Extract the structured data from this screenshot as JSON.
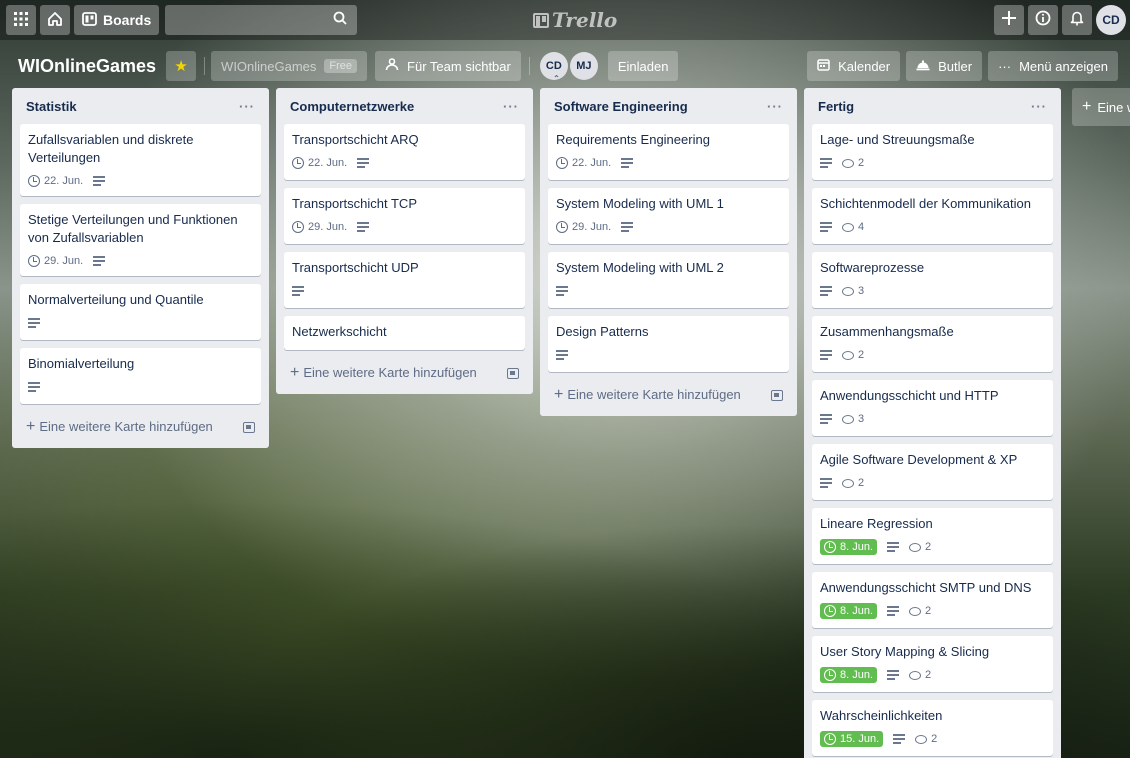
{
  "topbar": {
    "boards_label": "Boards",
    "logo_text": "Trello",
    "avatar_initials": "CD"
  },
  "board": {
    "title": "WIOnlineGames",
    "team_name": "WIOnlineGames",
    "team_plan": "Free",
    "visibility_label": "Für Team sichtbar",
    "members": [
      "CD",
      "MJ"
    ],
    "invite_label": "Einladen",
    "calendar_label": "Kalender",
    "butler_label": "Butler",
    "menu_label": "Menü anzeigen"
  },
  "add_list_label": "Eine w",
  "add_card_label": "Eine weitere Karte hinzufügen",
  "lists": [
    {
      "title": "Statistik",
      "cards": [
        {
          "title": "Zufallsvariablen und diskrete Verteilungen",
          "due": "22. Jun."
        },
        {
          "title": "Stetige Verteilungen und Funktionen von Zufallsvariablen",
          "due": "29. Jun."
        },
        {
          "title": "Normalverteilung und Quantile"
        },
        {
          "title": "Binomialverteilung"
        }
      ]
    },
    {
      "title": "Computernetzwerke",
      "cards": [
        {
          "title": "Transportschicht ARQ",
          "due": "22. Jun."
        },
        {
          "title": "Transportschicht TCP",
          "due": "29. Jun."
        },
        {
          "title": "Transportschicht UDP"
        },
        {
          "title": "Netzwerkschicht"
        }
      ]
    },
    {
      "title": "Software Engineering",
      "cards": [
        {
          "title": "Requirements Engineering",
          "due": "22. Jun."
        },
        {
          "title": "System Modeling with UML 1",
          "due": "29. Jun."
        },
        {
          "title": "System Modeling with UML 2"
        },
        {
          "title": "Design Patterns"
        }
      ]
    },
    {
      "title": "Fertig",
      "cards": [
        {
          "title": "Lage- und Streuungsmaße",
          "comments": "2"
        },
        {
          "title": "Schichtenmodell der Kommunikation",
          "comments": "4"
        },
        {
          "title": "Softwareprozesse",
          "comments": "3"
        },
        {
          "title": "Zusammenhangsmaße",
          "comments": "2"
        },
        {
          "title": "Anwendungsschicht und HTTP",
          "comments": "3"
        },
        {
          "title": "Agile Software Development & XP",
          "comments": "2"
        },
        {
          "title": "Lineare Regression",
          "due": "8. Jun.",
          "comments": "2"
        },
        {
          "title": "Anwendungsschicht SMTP und DNS",
          "due": "8. Jun.",
          "comments": "2"
        },
        {
          "title": "User Story Mapping & Slicing",
          "due": "8. Jun.",
          "comments": "2"
        },
        {
          "title": "Wahrscheinlichkeiten",
          "due": "15. Jun.",
          "comments": "2"
        }
      ]
    }
  ],
  "colors": {
    "due_complete": "#61bd4f",
    "star": "#f2d600",
    "list_bg": "#ebecf0"
  }
}
